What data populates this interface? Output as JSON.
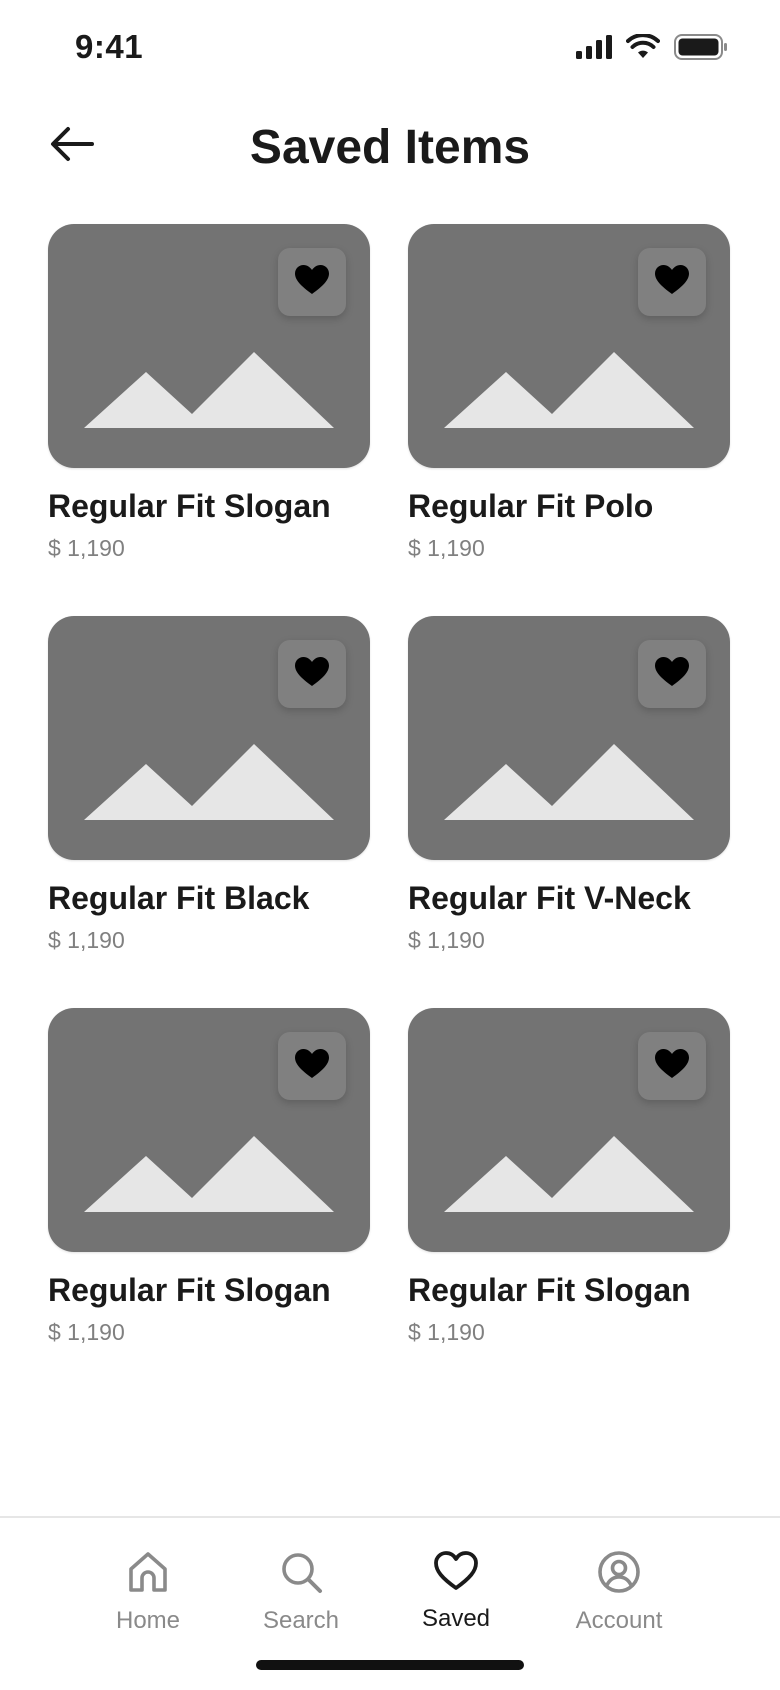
{
  "status_bar": {
    "time": "9:41",
    "icons": [
      "signal-icon",
      "wifi-icon",
      "battery-icon"
    ]
  },
  "header": {
    "back_icon": "arrow-left-icon",
    "title": "Saved Items"
  },
  "items": [
    {
      "title": "Regular Fit Slogan",
      "price": "$ 1,190",
      "favorited": true
    },
    {
      "title": "Regular Fit Polo",
      "price": "$ 1,190",
      "favorited": true
    },
    {
      "title": "Regular Fit Black",
      "price": "$ 1,190",
      "favorited": true
    },
    {
      "title": "Regular Fit V-Neck",
      "price": "$ 1,190",
      "favorited": true
    },
    {
      "title": "Regular Fit Slogan",
      "price": "$ 1,190",
      "favorited": true
    },
    {
      "title": "Regular Fit Slogan",
      "price": "$ 1,190",
      "favorited": true
    }
  ],
  "tab_bar": {
    "tabs": [
      {
        "label": "Home",
        "icon": "home-icon",
        "active": false
      },
      {
        "label": "Search",
        "icon": "search-icon",
        "active": false
      },
      {
        "label": "Saved",
        "icon": "heart-icon",
        "active": true
      },
      {
        "label": "Account",
        "icon": "account-icon",
        "active": false
      }
    ]
  },
  "colors": {
    "image_placeholder": "#737373",
    "placeholder_shape": "#e6e6e6",
    "fav_button_bg": "#808080",
    "text_primary": "#1a1a1a",
    "text_secondary": "#808080",
    "tab_inactive": "#8a8a8a"
  }
}
